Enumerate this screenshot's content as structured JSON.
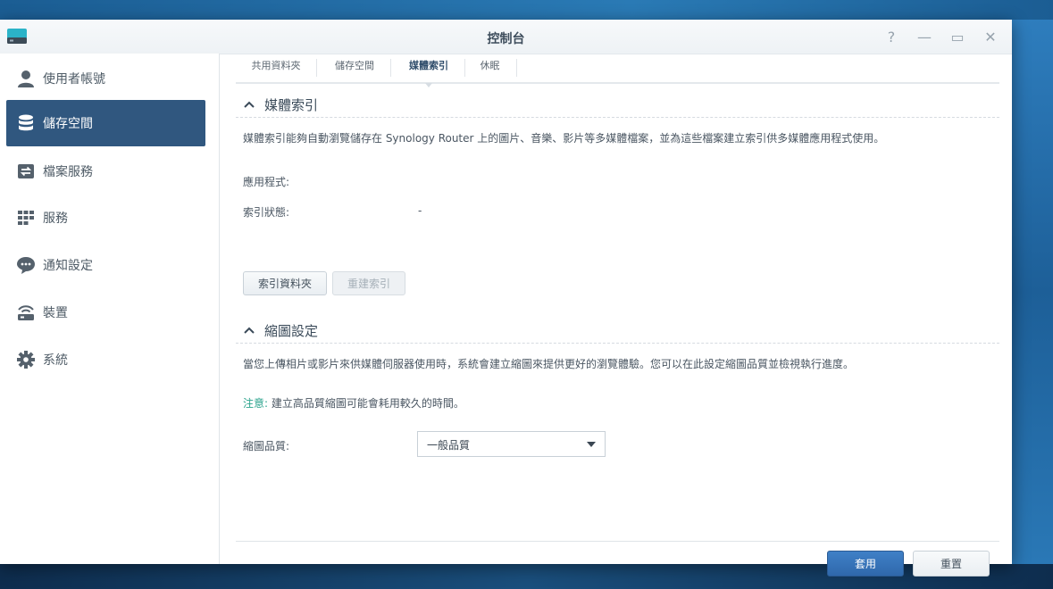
{
  "window": {
    "title": "控制台",
    "controls": [
      "?",
      "—",
      "▭",
      "✕"
    ]
  },
  "sidebar": {
    "items": [
      {
        "label": "使用者帳號",
        "icon": "user-icon",
        "active": false
      },
      {
        "label": "儲存空間",
        "icon": "database-icon",
        "active": true
      },
      {
        "label": "檔案服務",
        "icon": "file-exchange-icon",
        "active": false
      },
      {
        "label": "服務",
        "icon": "grid-icon",
        "active": false
      },
      {
        "label": "通知設定",
        "icon": "chat-bubble-icon",
        "active": false
      },
      {
        "label": "裝置",
        "icon": "router-icon",
        "active": false
      },
      {
        "label": "系統",
        "icon": "gear-icon",
        "active": false
      }
    ]
  },
  "tabs": [
    {
      "label": "共用資料夾",
      "active": false
    },
    {
      "label": "儲存空間",
      "active": false
    },
    {
      "label": "媒體索引",
      "active": true
    },
    {
      "label": "休眠",
      "active": false
    }
  ],
  "media_index": {
    "heading": "媒體索引",
    "description": "媒體索引能夠自動瀏覽儲存在 Synology Router 上的圖片、音樂、影片等多媒體檔案，並為這些檔案建立索引供多媒體應用程式使用。",
    "app_label": "應用程式:",
    "status_label": "索引狀態:",
    "status_value": "-",
    "index_folder_button": "索引資料夾",
    "reindex_button": "重建索引"
  },
  "thumbnail": {
    "heading": "縮圖設定",
    "description": "當您上傳相片或影片來供媒體伺服器使用時，系統會建立縮圖來提供更好的瀏覽體驗。您可以在此設定縮圖品質並檢視執行進度。",
    "note_label": "注意:",
    "note_text": " 建立高品質縮圖可能會耗用較久的時間。",
    "quality_label": "縮圖品質:",
    "quality_value": "一般品質"
  },
  "footer": {
    "apply_button": "套用",
    "reset_button": "重置"
  },
  "colors": {
    "sidebar_active": "#30577f",
    "primary_button": "#3574ba",
    "note": "#2aa38c"
  }
}
